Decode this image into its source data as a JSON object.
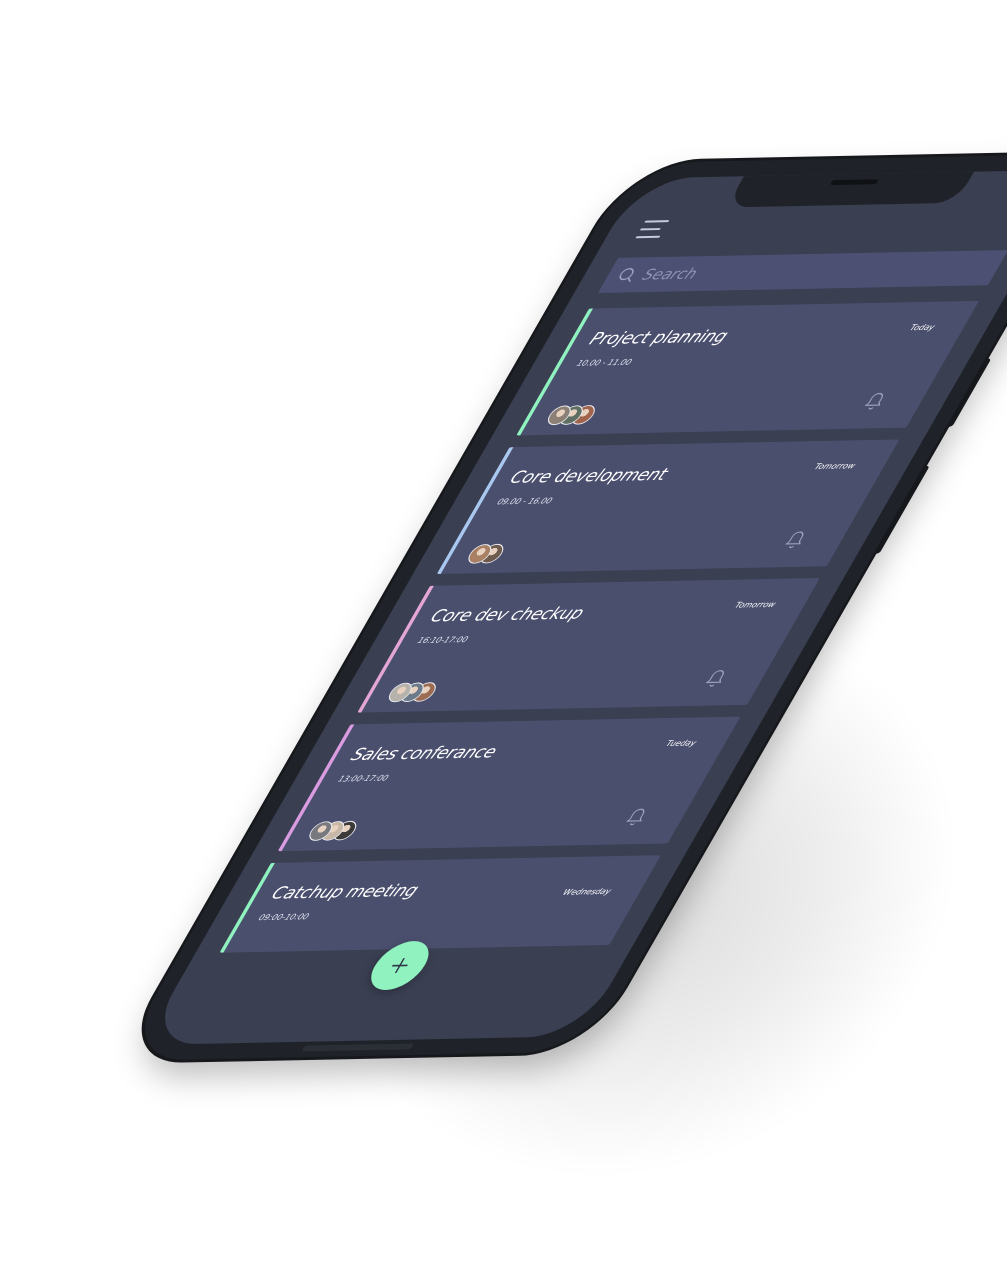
{
  "colors": {
    "screen_bg": "#3a3f52",
    "card_bg": "#4a4f6e",
    "search_bg": "#4c5174",
    "fab": "#8ff2bf",
    "text": "#ffffff"
  },
  "header": {
    "menu_icon": "menu-icon",
    "settings_icon": "gear-icon"
  },
  "search": {
    "icon": "search-icon",
    "placeholder": "Search",
    "value": ""
  },
  "events": [
    {
      "title": "Project planning",
      "time": "10.00 - 11.00",
      "day": "Today",
      "accent": "#8ff2bf",
      "avatars": [
        "#8b7f76",
        "#5f6f63",
        "#a0644c"
      ]
    },
    {
      "title": "Core development",
      "time": "09.00 - 16.00",
      "day": "Tomorrow",
      "accent": "#a9c8f0",
      "avatars": [
        "#a98064",
        "#6f5a4e"
      ]
    },
    {
      "title": "Core dev checkup",
      "time": "16:10-17:00",
      "day": "Tomorrow",
      "accent": "#e4a6d4",
      "avatars": [
        "#b8b2ac",
        "#6b7b8a",
        "#9b6b52"
      ]
    },
    {
      "title": "Sales conferance",
      "time": "13:00-17:00",
      "day": "Tueday",
      "accent": "#d99ce0",
      "avatars": [
        "#77797f",
        "#c6b7a6",
        "#3c3a38"
      ]
    },
    {
      "title": "Catchup meeting",
      "time": "09:00-10:00",
      "day": "Wednesday",
      "accent": "#8ff2bf",
      "avatars": []
    }
  ],
  "fab": {
    "icon": "plus-icon"
  }
}
